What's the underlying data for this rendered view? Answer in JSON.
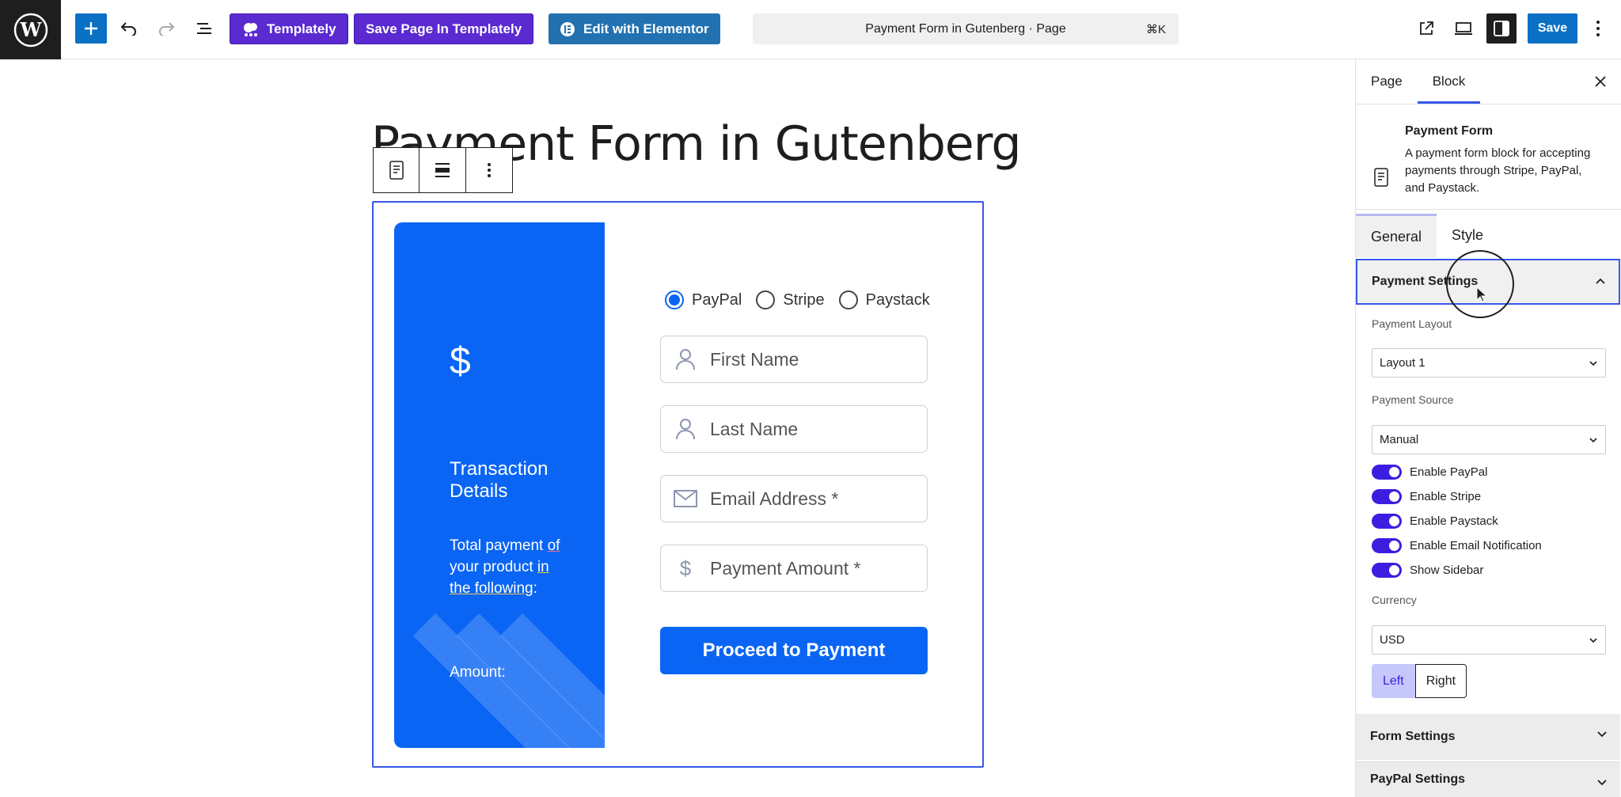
{
  "topbar": {
    "templately_label": "Templately",
    "save_templately_label": "Save Page In Templately",
    "elementor_label": "Edit with Elementor",
    "command_title": "Payment Form in Gutenberg · Page",
    "command_shortcut": "⌘K",
    "save_label": "Save",
    "accent": "#0a70c4",
    "templately_color": "#5b2ad1"
  },
  "canvas": {
    "page_title": "Payment Form in Gutenberg"
  },
  "form": {
    "sidebar": {
      "currency_symbol": "$",
      "title": "Transaction Details",
      "text_parts": [
        "Total payment ",
        "of",
        " your product ",
        "in the following",
        ":"
      ],
      "amount_label": "Amount:",
      "color": "#0a65f5"
    },
    "gateways": [
      {
        "label": "PayPal",
        "selected": true
      },
      {
        "label": "Stripe",
        "selected": false
      },
      {
        "label": "Paystack",
        "selected": false
      }
    ],
    "fields": {
      "first_name": "First Name",
      "last_name": "Last Name",
      "email": "Email Address *",
      "amount": "Payment Amount *"
    },
    "submit_label": "Proceed to Payment"
  },
  "sidebar": {
    "tabs": [
      "Page",
      "Block"
    ],
    "active_tab": "Block",
    "block_name": "Payment Form",
    "block_desc": "A payment form block for accepting payments through Stripe, PayPal, and Paystack.",
    "inner_tabs": [
      "General",
      "Style"
    ],
    "payment_settings_title": "Payment Settings",
    "payment_layout_label": "Payment Layout",
    "payment_layout_value": "Layout 1",
    "payment_source_label": "Payment Source",
    "payment_source_value": "Manual",
    "toggles": [
      {
        "label": "Enable PayPal",
        "on": true
      },
      {
        "label": "Enable Stripe",
        "on": true
      },
      {
        "label": "Enable Paystack",
        "on": true
      },
      {
        "label": "Enable Email Notification",
        "on": true
      },
      {
        "label": "Show Sidebar",
        "on": true
      }
    ],
    "currency_label": "Currency",
    "currency_value": "USD",
    "align_left": "Left",
    "align_right": "Right",
    "form_settings_title": "Form Settings",
    "paypal_settings_title": "PayPal Settings"
  }
}
